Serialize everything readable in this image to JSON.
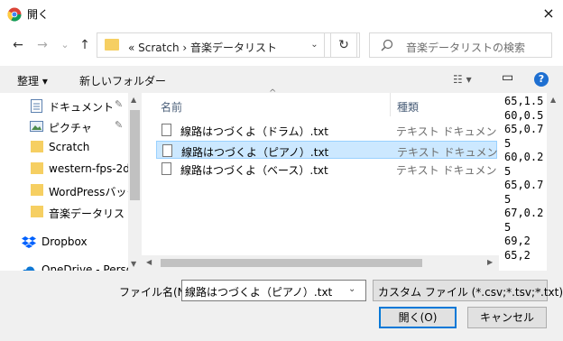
{
  "window": {
    "title": "開く",
    "close_icon": "×"
  },
  "nav_buttons": {
    "back": "←",
    "forward": "→",
    "recent": "⌄",
    "up": "↑"
  },
  "address": {
    "path": "«  Scratch  ›  音楽データリスト",
    "drop": "⌄",
    "refresh": "↻"
  },
  "search": {
    "placeholder": "音楽データリストの検索"
  },
  "toolbar": {
    "organize": "整理 ▾",
    "new_folder": "新しいフォルダー",
    "view": "☷ ▾",
    "preview_toggle": "▭",
    "help": "?"
  },
  "sidebar": {
    "items": [
      {
        "label": "ドキュメント",
        "icon": "document-icon",
        "pinned": true
      },
      {
        "label": "ピクチャ",
        "icon": "pictures-icon",
        "pinned": true
      },
      {
        "label": "Scratch",
        "icon": "folder-icon",
        "pinned": false
      },
      {
        "label": "western-fps-2d",
        "icon": "folder-icon",
        "pinned": false
      },
      {
        "label": "WordPressバック",
        "icon": "folder-icon",
        "pinned": false
      },
      {
        "label": "音楽データリスト",
        "icon": "folder-icon",
        "pinned": false
      },
      {
        "label": "Dropbox",
        "icon": "dropbox-icon",
        "pinned": false
      },
      {
        "label": "OneDrive - Person",
        "icon": "onedrive-icon",
        "pinned": false
      }
    ],
    "pin_glyph": "✎"
  },
  "file_list": {
    "sort_arrow": "^",
    "columns": [
      "名前",
      "種類"
    ],
    "files": [
      {
        "name": "線路はつづくよ（ドラム）.txt",
        "type": "テキスト ドキュメント",
        "selected": false
      },
      {
        "name": "線路はつづくよ（ピアノ）.txt",
        "type": "テキスト ドキュメント",
        "selected": true
      },
      {
        "name": "線路はつづくよ（ベース）.txt",
        "type": "テキスト ドキュメント",
        "selected": false
      }
    ]
  },
  "preview": {
    "lines": [
      "65,1.5",
      "60,0.5",
      "65,0.7",
      "5",
      "60,0.2",
      "5",
      "65,0.7",
      "5",
      "67,0.2",
      "5",
      "69,2",
      "65,2"
    ]
  },
  "bottom": {
    "filename_label": "ファイル名(N):",
    "filename_value": "線路はつづくよ（ピアノ）.txt",
    "filter_value": "カスタム ファイル (*.csv;*.tsv;*.txt)",
    "open_button": "開く(O)",
    "cancel_button": "キャンセル",
    "drop": "⌄"
  },
  "colors": {
    "selection": "#cce8ff",
    "accent": "#0078d7",
    "folder": "#f6cf62"
  }
}
